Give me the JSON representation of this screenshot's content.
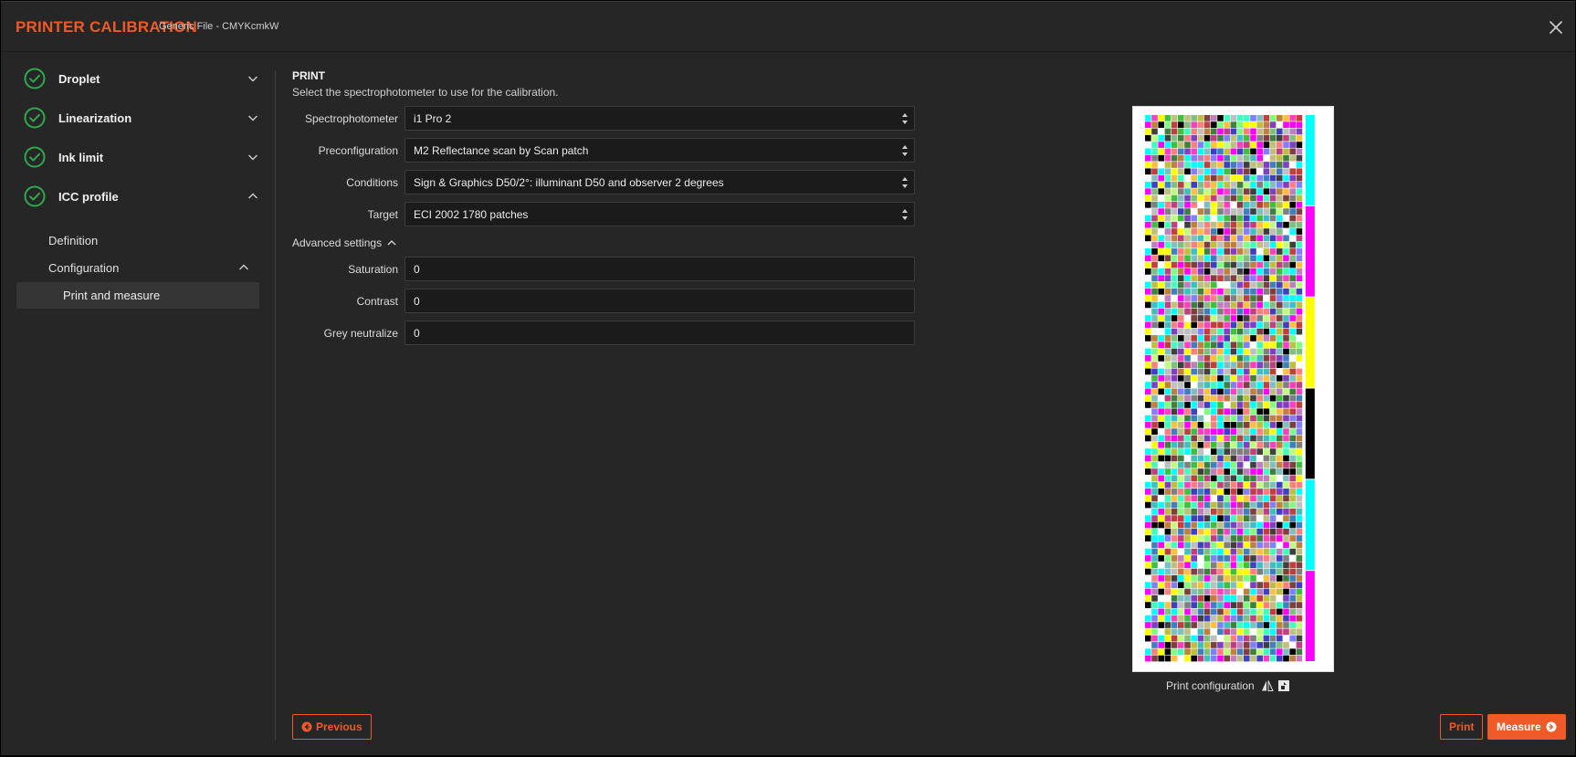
{
  "header": {
    "title": "PRINTER CALIBRATION",
    "subtitle": "Generic File - CMYKcmkW"
  },
  "sidebar": {
    "steps": [
      {
        "label": "Droplet",
        "status": "complete",
        "expanded": false
      },
      {
        "label": "Linearization",
        "status": "complete",
        "expanded": false
      },
      {
        "label": "Ink limit",
        "status": "complete",
        "expanded": false
      },
      {
        "label": "ICC profile",
        "status": "complete",
        "expanded": true
      }
    ],
    "substeps": [
      {
        "label": "Definition"
      },
      {
        "label": "Configuration",
        "expanded": true
      }
    ],
    "active_item": "Print and measure"
  },
  "main": {
    "section_title": "PRINT",
    "section_desc": "Select the spectrophotometer to use for the calibration.",
    "fields": {
      "spectrophotometer": {
        "label": "Spectrophotometer",
        "value": "i1 Pro 2"
      },
      "preconfiguration": {
        "label": "Preconfiguration",
        "value": "M2 Reflectance scan by Scan patch"
      },
      "conditions": {
        "label": "Conditions",
        "value": "Sign & Graphics D50/2°: illuminant D50 and observer 2 degrees"
      },
      "target": {
        "label": "Target",
        "value": "ECI 2002 1780 patches"
      }
    },
    "advanced_toggle": "Advanced settings",
    "advanced": {
      "saturation": {
        "label": "Saturation",
        "value": "0"
      },
      "contrast": {
        "label": "Contrast",
        "value": "0"
      },
      "grey_neutralize": {
        "label": "Grey neutralize",
        "value": "0"
      }
    }
  },
  "preview": {
    "caption": "Print configuration",
    "icons": [
      "flip-horizontal-icon",
      "print-settings-icon"
    ]
  },
  "buttons": {
    "previous": "Previous",
    "print": "Print",
    "measure": "Measure"
  },
  "colors": {
    "accent": "#ef5a28",
    "check": "#2fa84f",
    "background": "#262626"
  }
}
